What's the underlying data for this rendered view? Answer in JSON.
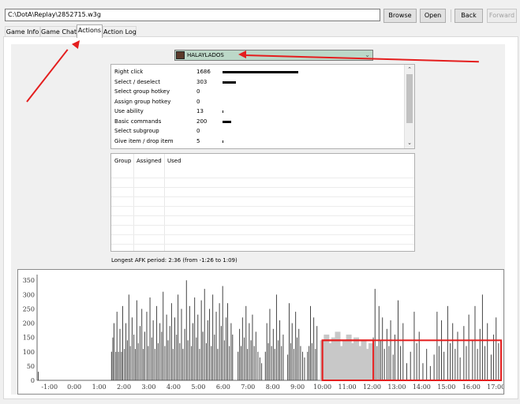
{
  "toolbar": {
    "path": "C:\\DotA\\Replay\\2852715.w3g",
    "browse_label": "Browse",
    "open_label": "Open",
    "back_label": "Back",
    "forward_label": "Forward"
  },
  "tabs": [
    {
      "label": "Game Info",
      "active": false
    },
    {
      "label": "Game Chat",
      "active": false
    },
    {
      "label": "Actions",
      "active": true
    },
    {
      "label": "Action Log",
      "active": false
    }
  ],
  "player": {
    "name": "HALAYLADOS",
    "avatar_icon": "hero-portrait-icon",
    "chevron_icon": "chevron-down-icon"
  },
  "action_stats": [
    {
      "name": "Right click",
      "value": "1686",
      "count": 1686
    },
    {
      "name": "Select / deselect",
      "value": "303",
      "count": 303
    },
    {
      "name": "Select group hotkey",
      "value": "0",
      "count": 0
    },
    {
      "name": "Assign group hotkey",
      "value": "0",
      "count": 0
    },
    {
      "name": "Use ability",
      "value": "13",
      "count": 13
    },
    {
      "name": "Basic commands",
      "value": "200",
      "count": 200
    },
    {
      "name": "Select subgroup",
      "value": "0",
      "count": 0
    },
    {
      "name": "Give item / drop item",
      "value": "5",
      "count": 5
    }
  ],
  "stats_max": 1686,
  "hotkey_table": {
    "columns": [
      "Group",
      "Assigned",
      "Used"
    ],
    "rows": []
  },
  "afk_text": "Longest AFK period: 2:36 (from -1:26 to 1:09)",
  "annotation_color": "#e41e1e",
  "chart_data": {
    "type": "bar",
    "title": "",
    "xlabel": "",
    "ylabel": "",
    "ylim": [
      0,
      370
    ],
    "yticks": [
      0,
      50,
      100,
      150,
      200,
      250,
      300,
      350
    ],
    "xticks": [
      "-1:00",
      "0:00",
      "1:00",
      "2:00",
      "3:00",
      "4:00",
      "5:00",
      "6:00",
      "7:00",
      "8:00",
      "9:00",
      "10:00",
      "11:00",
      "12:00",
      "13:00",
      "14:00",
      "15:00",
      "16:00",
      "17:00"
    ],
    "xrange_minutes": [
      -1.5,
      17.2
    ],
    "bar_color": "#444444",
    "points": [
      {
        "t": -1.45,
        "v": 30
      },
      {
        "t": 1.5,
        "v": 100
      },
      {
        "t": 1.55,
        "v": 150
      },
      {
        "t": 1.6,
        "v": 200
      },
      {
        "t": 1.67,
        "v": 100
      },
      {
        "t": 1.72,
        "v": 240
      },
      {
        "t": 1.78,
        "v": 100
      },
      {
        "t": 1.84,
        "v": 180
      },
      {
        "t": 1.9,
        "v": 100
      },
      {
        "t": 1.95,
        "v": 260
      },
      {
        "t": 2.02,
        "v": 110
      },
      {
        "t": 2.08,
        "v": 200
      },
      {
        "t": 2.14,
        "v": 140
      },
      {
        "t": 2.2,
        "v": 300
      },
      {
        "t": 2.26,
        "v": 120
      },
      {
        "t": 2.33,
        "v": 220
      },
      {
        "t": 2.4,
        "v": 160
      },
      {
        "t": 2.46,
        "v": 110
      },
      {
        "t": 2.52,
        "v": 280
      },
      {
        "t": 2.58,
        "v": 130
      },
      {
        "t": 2.65,
        "v": 190
      },
      {
        "t": 2.72,
        "v": 250
      },
      {
        "t": 2.78,
        "v": 110
      },
      {
        "t": 2.84,
        "v": 170
      },
      {
        "t": 2.92,
        "v": 240
      },
      {
        "t": 2.98,
        "v": 120
      },
      {
        "t": 3.05,
        "v": 290
      },
      {
        "t": 3.12,
        "v": 150
      },
      {
        "t": 3.18,
        "v": 210
      },
      {
        "t": 3.25,
        "v": 110
      },
      {
        "t": 3.32,
        "v": 260
      },
      {
        "t": 3.38,
        "v": 130
      },
      {
        "t": 3.45,
        "v": 200
      },
      {
        "t": 3.52,
        "v": 170
      },
      {
        "t": 3.58,
        "v": 310
      },
      {
        "t": 3.65,
        "v": 120
      },
      {
        "t": 3.72,
        "v": 230
      },
      {
        "t": 3.78,
        "v": 140
      },
      {
        "t": 3.85,
        "v": 190
      },
      {
        "t": 3.92,
        "v": 270
      },
      {
        "t": 3.98,
        "v": 110
      },
      {
        "t": 4.05,
        "v": 220
      },
      {
        "t": 4.12,
        "v": 160
      },
      {
        "t": 4.18,
        "v": 300
      },
      {
        "t": 4.25,
        "v": 130
      },
      {
        "t": 4.32,
        "v": 250
      },
      {
        "t": 4.38,
        "v": 110
      },
      {
        "t": 4.45,
        "v": 180
      },
      {
        "t": 4.52,
        "v": 350
      },
      {
        "t": 4.58,
        "v": 140
      },
      {
        "t": 4.65,
        "v": 260
      },
      {
        "t": 4.72,
        "v": 120
      },
      {
        "t": 4.78,
        "v": 200
      },
      {
        "t": 4.85,
        "v": 290
      },
      {
        "t": 4.92,
        "v": 150
      },
      {
        "t": 4.98,
        "v": 230
      },
      {
        "t": 5.05,
        "v": 110
      },
      {
        "t": 5.12,
        "v": 280
      },
      {
        "t": 5.18,
        "v": 170
      },
      {
        "t": 5.25,
        "v": 320
      },
      {
        "t": 5.32,
        "v": 130
      },
      {
        "t": 5.38,
        "v": 210
      },
      {
        "t": 5.45,
        "v": 250
      },
      {
        "t": 5.52,
        "v": 120
      },
      {
        "t": 5.58,
        "v": 300
      },
      {
        "t": 5.65,
        "v": 160
      },
      {
        "t": 5.72,
        "v": 240
      },
      {
        "t": 5.78,
        "v": 110
      },
      {
        "t": 5.85,
        "v": 270
      },
      {
        "t": 5.92,
        "v": 190
      },
      {
        "t": 5.98,
        "v": 330
      },
      {
        "t": 6.05,
        "v": 140
      },
      {
        "t": 6.12,
        "v": 220
      },
      {
        "t": 6.18,
        "v": 270
      },
      {
        "t": 6.25,
        "v": 120
      },
      {
        "t": 6.32,
        "v": 200
      },
      {
        "t": 6.38,
        "v": 160
      },
      {
        "t": 6.6,
        "v": 100
      },
      {
        "t": 6.66,
        "v": 180
      },
      {
        "t": 6.72,
        "v": 120
      },
      {
        "t": 6.78,
        "v": 220
      },
      {
        "t": 6.85,
        "v": 150
      },
      {
        "t": 6.92,
        "v": 260
      },
      {
        "t": 6.98,
        "v": 110
      },
      {
        "t": 7.05,
        "v": 200
      },
      {
        "t": 7.12,
        "v": 140
      },
      {
        "t": 7.18,
        "v": 230
      },
      {
        "t": 7.25,
        "v": 120
      },
      {
        "t": 7.32,
        "v": 170
      },
      {
        "t": 7.4,
        "v": 100
      },
      {
        "t": 7.48,
        "v": 80
      },
      {
        "t": 7.55,
        "v": 60
      },
      {
        "t": 7.7,
        "v": 100
      },
      {
        "t": 7.76,
        "v": 200
      },
      {
        "t": 7.82,
        "v": 130
      },
      {
        "t": 7.88,
        "v": 250
      },
      {
        "t": 7.95,
        "v": 120
      },
      {
        "t": 8.02,
        "v": 180
      },
      {
        "t": 8.08,
        "v": 110
      },
      {
        "t": 8.15,
        "v": 300
      },
      {
        "t": 8.22,
        "v": 140
      },
      {
        "t": 8.28,
        "v": 210
      },
      {
        "t": 8.35,
        "v": 120
      },
      {
        "t": 8.42,
        "v": 160
      },
      {
        "t": 8.6,
        "v": 90
      },
      {
        "t": 8.66,
        "v": 270
      },
      {
        "t": 8.72,
        "v": 130
      },
      {
        "t": 8.78,
        "v": 200
      },
      {
        "t": 8.85,
        "v": 110
      },
      {
        "t": 8.92,
        "v": 240
      },
      {
        "t": 8.98,
        "v": 150
      },
      {
        "t": 9.05,
        "v": 180
      },
      {
        "t": 9.12,
        "v": 120
      },
      {
        "t": 9.2,
        "v": 100
      },
      {
        "t": 9.28,
        "v": 80
      },
      {
        "t": 9.4,
        "v": 100
      },
      {
        "t": 9.46,
        "v": 120
      },
      {
        "t": 9.52,
        "v": 260
      },
      {
        "t": 9.58,
        "v": 130
      },
      {
        "t": 9.65,
        "v": 220
      },
      {
        "t": 9.72,
        "v": 110
      },
      {
        "t": 9.78,
        "v": 190
      },
      {
        "t": 10.0,
        "v": 140
      },
      {
        "t": 10.15,
        "v": 160
      },
      {
        "t": 10.3,
        "v": 130
      },
      {
        "t": 10.45,
        "v": 150
      },
      {
        "t": 10.6,
        "v": 170
      },
      {
        "t": 10.75,
        "v": 120
      },
      {
        "t": 10.9,
        "v": 140
      },
      {
        "t": 11.05,
        "v": 160
      },
      {
        "t": 11.2,
        "v": 130
      },
      {
        "t": 11.35,
        "v": 150
      },
      {
        "t": 11.5,
        "v": 120
      },
      {
        "t": 11.65,
        "v": 140
      },
      {
        "t": 11.8,
        "v": 110
      },
      {
        "t": 11.95,
        "v": 130
      },
      {
        "t": 12.05,
        "v": 150
      },
      {
        "t": 12.12,
        "v": 320
      },
      {
        "t": 12.2,
        "v": 120
      },
      {
        "t": 12.28,
        "v": 260
      },
      {
        "t": 12.35,
        "v": 140
      },
      {
        "t": 12.42,
        "v": 220
      },
      {
        "t": 12.5,
        "v": 110
      },
      {
        "t": 12.6,
        "v": 180
      },
      {
        "t": 12.68,
        "v": 120
      },
      {
        "t": 12.75,
        "v": 210
      },
      {
        "t": 12.85,
        "v": 90
      },
      {
        "t": 12.92,
        "v": 160
      },
      {
        "t": 13.05,
        "v": 280
      },
      {
        "t": 13.15,
        "v": 120
      },
      {
        "t": 13.25,
        "v": 200
      },
      {
        "t": 13.4,
        "v": 60
      },
      {
        "t": 13.55,
        "v": 100
      },
      {
        "t": 13.7,
        "v": 240
      },
      {
        "t": 13.8,
        "v": 130
      },
      {
        "t": 13.9,
        "v": 170
      },
      {
        "t": 14.05,
        "v": 60
      },
      {
        "t": 14.2,
        "v": 110
      },
      {
        "t": 14.35,
        "v": 50
      },
      {
        "t": 14.5,
        "v": 90
      },
      {
        "t": 14.62,
        "v": 240
      },
      {
        "t": 14.7,
        "v": 120
      },
      {
        "t": 14.8,
        "v": 210
      },
      {
        "t": 14.9,
        "v": 100
      },
      {
        "t": 15.05,
        "v": 260
      },
      {
        "t": 15.15,
        "v": 130
      },
      {
        "t": 15.25,
        "v": 200
      },
      {
        "t": 15.35,
        "v": 110
      },
      {
        "t": 15.45,
        "v": 170
      },
      {
        "t": 15.55,
        "v": 80
      },
      {
        "t": 15.7,
        "v": 190
      },
      {
        "t": 15.8,
        "v": 120
      },
      {
        "t": 15.9,
        "v": 230
      },
      {
        "t": 16.05,
        "v": 140
      },
      {
        "t": 16.15,
        "v": 260
      },
      {
        "t": 16.25,
        "v": 110
      },
      {
        "t": 16.35,
        "v": 180
      },
      {
        "t": 16.45,
        "v": 300
      },
      {
        "t": 16.55,
        "v": 120
      },
      {
        "t": 16.65,
        "v": 200
      },
      {
        "t": 16.8,
        "v": 90
      },
      {
        "t": 16.9,
        "v": 160
      },
      {
        "t": 17.0,
        "v": 220
      },
      {
        "t": 17.1,
        "v": 130
      }
    ]
  },
  "highlight_boxes": [
    {
      "label": "redacted-region",
      "from": 10.0,
      "to": 12.05,
      "top_value": 140
    },
    {
      "label": "late-game-region",
      "from": 10.0,
      "to": 17.2,
      "top_value": 140
    }
  ]
}
